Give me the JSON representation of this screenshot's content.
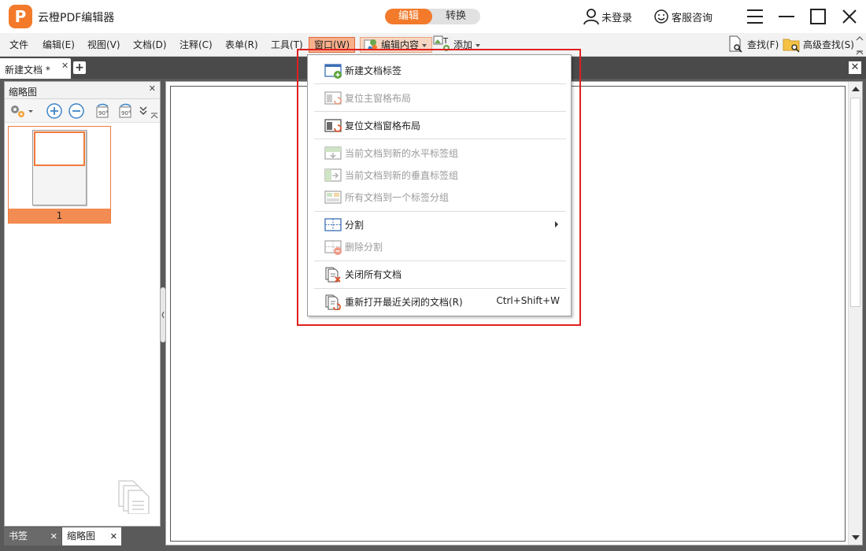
{
  "app": {
    "title": "云橙PDF编辑器",
    "logo_letter": "P"
  },
  "mode_switch": {
    "edit": "编辑",
    "convert": "转换"
  },
  "header_actions": {
    "login": "未登录",
    "support": "客服咨询"
  },
  "menu": {
    "file": "文件",
    "edit": "编辑(E)",
    "view": "视图(V)",
    "document": "文档(D)",
    "annotate": "注释(C)",
    "form": "表单(R)",
    "tools": "工具(T)",
    "window": "窗口(W)",
    "edit_content": "编辑内容",
    "add": "添加",
    "find": "查找(F)",
    "advanced_find": "高级查找(S)"
  },
  "tabs": {
    "doc_tab": "新建文档 *"
  },
  "left_panel": {
    "title": "缩略图",
    "page_number": "1"
  },
  "panel_tabs": {
    "bookmarks": "书签",
    "thumbnails": "缩略图"
  },
  "dropdown": {
    "items": [
      {
        "label": "新建文档标签",
        "disabled": false
      },
      {
        "label": "复位主窗格布局",
        "disabled": true
      },
      {
        "label": "复位文档窗格布局",
        "disabled": false
      },
      {
        "label": "当前文档到新的水平标签组",
        "disabled": true
      },
      {
        "label": "当前文档到新的垂直标签组",
        "disabled": true
      },
      {
        "label": "所有文档到一个标签分组",
        "disabled": true
      },
      {
        "label": "分割",
        "disabled": false
      },
      {
        "label": "删除分割",
        "disabled": true
      },
      {
        "label": "关闭所有文档",
        "disabled": false
      },
      {
        "label": "重新打开最近关闭的文档(R)",
        "disabled": false,
        "shortcut": "Ctrl+Shift+W"
      }
    ]
  },
  "colors": {
    "accent": "#f27a2a",
    "highlight": "#e02020",
    "tab_bg": "#4a4a4a"
  }
}
